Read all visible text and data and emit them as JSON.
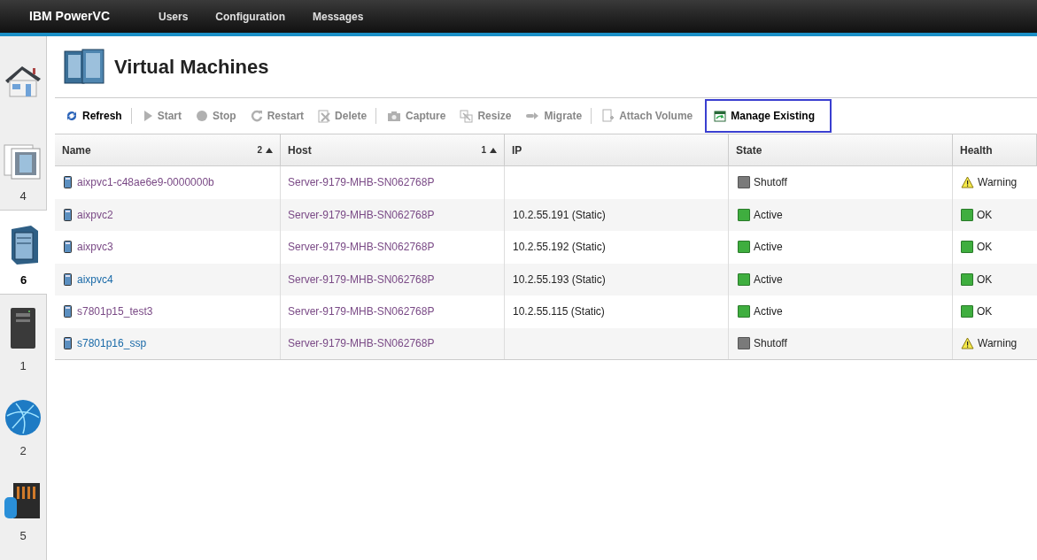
{
  "topbar": {
    "brand": "IBM PowerVC",
    "menu": [
      "Users",
      "Configuration",
      "Messages"
    ]
  },
  "sidebar": {
    "items": [
      {
        "kind": "home",
        "selected": false
      },
      {
        "kind": "images",
        "count": "4",
        "selected": false
      },
      {
        "kind": "vms",
        "count": "6",
        "selected": true
      },
      {
        "kind": "hosts",
        "count": "1",
        "selected": false
      },
      {
        "kind": "networks",
        "count": "2",
        "selected": false
      },
      {
        "kind": "storage",
        "count": "5",
        "selected": false
      }
    ]
  },
  "page": {
    "title": "Virtual Machines"
  },
  "toolbar": [
    {
      "kind": "refresh",
      "label": "Refresh",
      "disabled": false,
      "focused": false,
      "separator_after": true
    },
    {
      "kind": "start",
      "label": "Start",
      "disabled": true,
      "focused": false,
      "separator_after": false
    },
    {
      "kind": "stop",
      "label": "Stop",
      "disabled": true,
      "focused": false,
      "separator_after": false
    },
    {
      "kind": "restart",
      "label": "Restart",
      "disabled": true,
      "focused": false,
      "separator_after": false
    },
    {
      "kind": "delete",
      "label": "Delete",
      "disabled": true,
      "focused": false,
      "separator_after": true
    },
    {
      "kind": "capture",
      "label": "Capture",
      "disabled": true,
      "focused": false,
      "separator_after": false
    },
    {
      "kind": "resize",
      "label": "Resize",
      "disabled": true,
      "focused": false,
      "separator_after": false
    },
    {
      "kind": "migrate",
      "label": "Migrate",
      "disabled": true,
      "focused": false,
      "separator_after": true
    },
    {
      "kind": "attach",
      "label": "Attach Volume",
      "disabled": true,
      "focused": false,
      "separator_after": false
    },
    {
      "kind": "manage",
      "label": "Manage Existing",
      "disabled": false,
      "focused": true,
      "separator_after": false
    }
  ],
  "table": {
    "columns": [
      {
        "label": "Name",
        "sort_rank": "2"
      },
      {
        "label": "Host",
        "sort_rank": "1"
      },
      {
        "label": "IP"
      },
      {
        "label": "State"
      },
      {
        "label": "Health"
      }
    ],
    "rows": [
      {
        "name": "aixpvc1-c48ae6e9-0000000b",
        "visited": true,
        "host": "Server-9179-MHB-SN062768P",
        "ip": "",
        "state": {
          "kind": "shutoff",
          "label": "Shutoff"
        },
        "health": {
          "kind": "warning",
          "label": "Warning"
        }
      },
      {
        "name": "aixpvc2",
        "visited": true,
        "host": "Server-9179-MHB-SN062768P",
        "ip": "10.2.55.191 (Static)",
        "state": {
          "kind": "active",
          "label": "Active"
        },
        "health": {
          "kind": "ok",
          "label": "OK"
        }
      },
      {
        "name": "aixpvc3",
        "visited": true,
        "host": "Server-9179-MHB-SN062768P",
        "ip": "10.2.55.192 (Static)",
        "state": {
          "kind": "active",
          "label": "Active"
        },
        "health": {
          "kind": "ok",
          "label": "OK"
        }
      },
      {
        "name": "aixpvc4",
        "visited": false,
        "host": "Server-9179-MHB-SN062768P",
        "ip": "10.2.55.193 (Static)",
        "state": {
          "kind": "active",
          "label": "Active"
        },
        "health": {
          "kind": "ok",
          "label": "OK"
        }
      },
      {
        "name": "s7801p15_test3",
        "visited": true,
        "host": "Server-9179-MHB-SN062768P",
        "ip": "10.2.55.115 (Static)",
        "state": {
          "kind": "active",
          "label": "Active"
        },
        "health": {
          "kind": "ok",
          "label": "OK"
        }
      },
      {
        "name": "s7801p16_ssp",
        "visited": false,
        "host": "Server-9179-MHB-SN062768P",
        "ip": "",
        "state": {
          "kind": "shutoff",
          "label": "Shutoff"
        },
        "health": {
          "kind": "warning",
          "label": "Warning"
        }
      }
    ]
  }
}
